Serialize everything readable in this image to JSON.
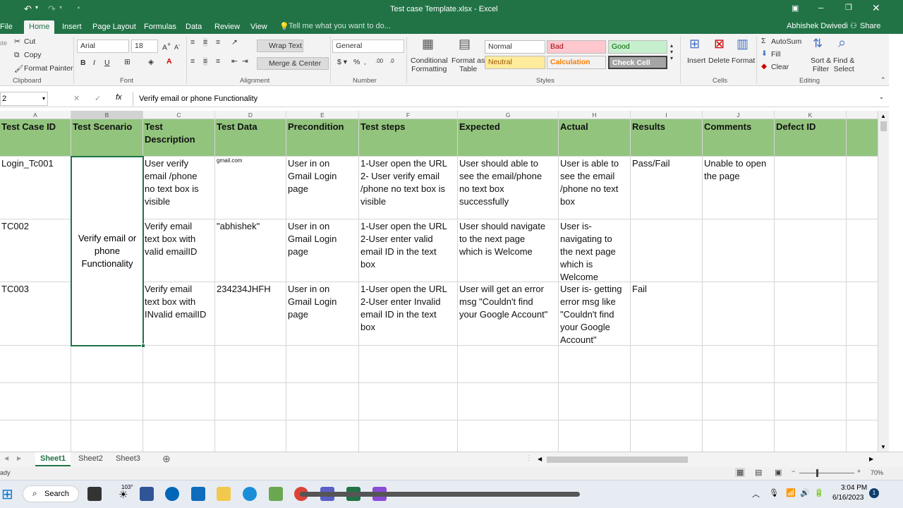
{
  "window": {
    "title": "Test case Template.xlsx - Excel"
  },
  "ribbon_tabs": [
    "File",
    "Home",
    "Insert",
    "Page Layout",
    "Formulas",
    "Data",
    "Review",
    "View"
  ],
  "tell_me": "Tell me what you want to do...",
  "user": "Abhishek Dwivedi",
  "share": "Share",
  "clipboard": {
    "cut": "Cut",
    "copy": "Copy",
    "format_painter": "Format Painter",
    "label": "Clipboard"
  },
  "font": {
    "name": "Arial",
    "size": "18",
    "label": "Font"
  },
  "alignment": {
    "wrap": "Wrap Text",
    "merge": "Merge & Center",
    "label": "Alignment"
  },
  "number": {
    "format": "General",
    "label": "Number"
  },
  "styles": {
    "conditional": "Conditional\nFormatting",
    "format_table": "Format as\nTable",
    "normal": "Normal",
    "bad": "Bad",
    "good": "Good",
    "neutral": "Neutral",
    "calculation": "Calculation",
    "check_cell": "Check Cell",
    "label": "Styles"
  },
  "cells": {
    "insert": "Insert",
    "delete": "Delete",
    "format": "Format",
    "label": "Cells"
  },
  "editing": {
    "autosum": "AutoSum",
    "fill": "Fill",
    "clear": "Clear",
    "sort": "Sort &\nFilter",
    "find": "Find &\nSelect",
    "label": "Editing"
  },
  "name_box": "2",
  "fx": "fx",
  "formula": "Verify email or phone Functionality",
  "col_letters": [
    "A",
    "B",
    "C",
    "D",
    "E",
    "F",
    "G",
    "H",
    "I",
    "J",
    "K"
  ],
  "headers": [
    "Test Case ID",
    "Test Scenario",
    "Test\nDescription",
    "Test Data",
    "Precondition",
    "Test steps",
    "Expected",
    "Actual",
    "Results",
    "Comments",
    "Defect ID"
  ],
  "rows": [
    [
      "Login_Tc001",
      "",
      "User verify\nemail /phone\nno text box is\nvisible",
      "gmail.com",
      "User in on\nGmail Login\npage",
      "1-User open the URL\n2- User verify email\n/phone no text box is\nvisible",
      "User should able to\nsee the email/phone\nno text box\nsuccessfully",
      "User is able to\nsee the email\n/phone no text\nbox",
      "Pass/Fail",
      "Unable to open\nthe page",
      ""
    ],
    [
      "TC002",
      "",
      "Verify email\ntext box with\nvalid emailID",
      "\"abhishek\"",
      "User in on\nGmail Login\npage",
      "1-User open the URL\n2-User enter valid\nemail ID in the text\nbox",
      "User should navigate\nto the next page\nwhich is Welcome",
      "User is-\nnavigating to\nthe next page\nwhich is\nWelcome",
      "",
      "",
      ""
    ],
    [
      "TC003",
      "",
      "Verify email\ntext box with\nINvalid emailID",
      "234234JHFH",
      "User in on\nGmail Login\npage",
      "1-User open the URL\n2-User enter Invalid\nemail ID in the text\nbox",
      "User will get an error\nmsg \"Couldn't find\nyour Google Account\"",
      "User is- getting\nerror msg like\n\"Couldn't find\nyour Google\nAccount\"",
      "Fail",
      "",
      ""
    ]
  ],
  "merged_scenario": "Verify email or\nphone\nFunctionality",
  "sheets": [
    "Sheet1",
    "Sheet2",
    "Sheet3"
  ],
  "status": {
    "ready": "ady",
    "zoom": "70%"
  },
  "taskbar": {
    "search": "Search",
    "temp": "103°",
    "time": "3:04 PM",
    "date": "6/16/2023",
    "notif": "1"
  }
}
